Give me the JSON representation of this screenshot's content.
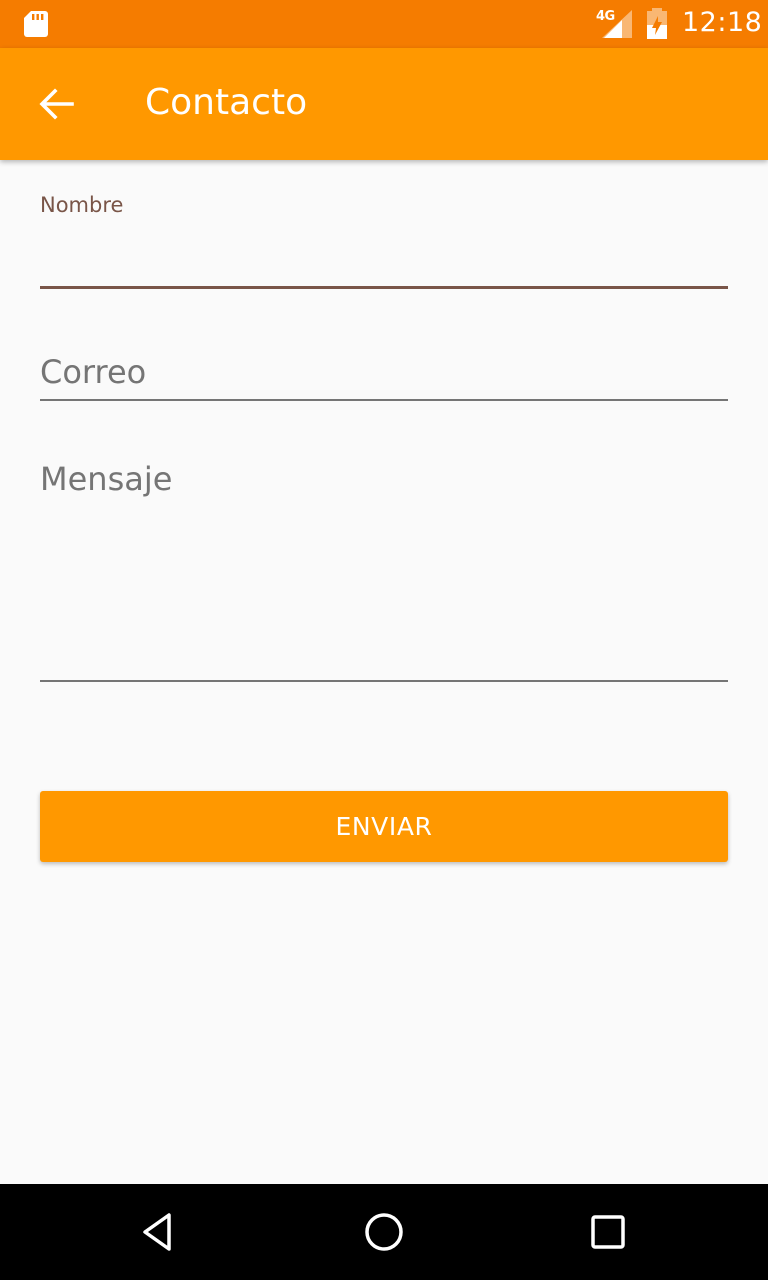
{
  "status_bar": {
    "network_type": "4G",
    "time": "12:18",
    "icons": [
      "sd-card-icon",
      "signal-icon",
      "battery-icon"
    ]
  },
  "app_bar": {
    "title": "Contacto",
    "back_icon": "arrow-back-icon"
  },
  "form": {
    "nombre": {
      "label": "Nombre",
      "value": ""
    },
    "correo": {
      "placeholder": "Correo",
      "value": ""
    },
    "mensaje": {
      "placeholder": "Mensaje",
      "value": ""
    },
    "submit_label": "ENVIAR"
  },
  "nav_bar": {
    "icons": [
      "nav-back-icon",
      "nav-home-icon",
      "nav-recents-icon"
    ]
  },
  "colors": {
    "status_bar": "#F57C00",
    "primary": "#FF9800",
    "accent": "#795548",
    "background": "#FAFAFA",
    "nav_bar": "#000000"
  }
}
